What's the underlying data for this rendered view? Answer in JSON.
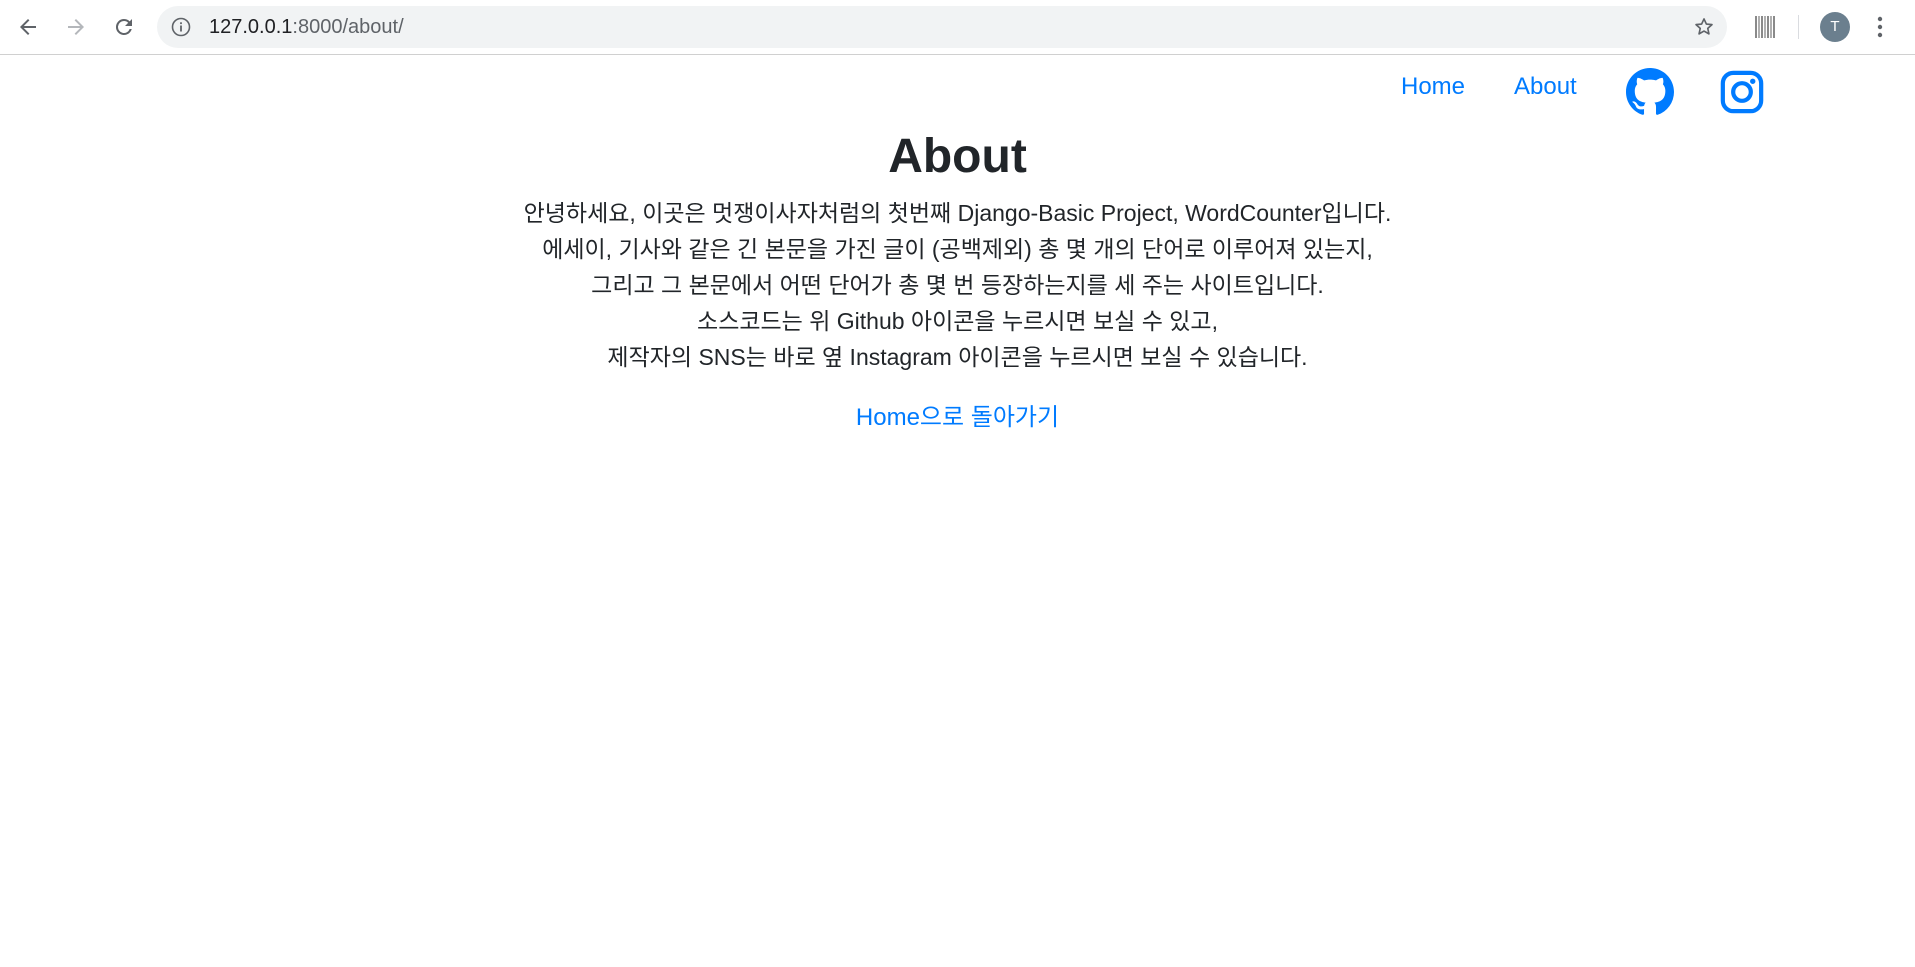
{
  "browser": {
    "url_host": "127.0.0.1",
    "url_rest": ":8000/about/",
    "profile_initial": "T"
  },
  "nav": {
    "links": [
      {
        "label": "Home"
      },
      {
        "label": "About"
      }
    ],
    "icons": [
      "github-icon",
      "instagram-icon"
    ],
    "accent_color": "#007bff"
  },
  "main": {
    "title": "About",
    "lines": [
      "안녕하세요, 이곳은 멋쟁이사자처럼의 첫번째 Django-Basic Project, WordCounter입니다.",
      "에세이, 기사와 같은 긴 본문을 가진 글이 (공백제외) 총 몇 개의 단어로 이루어져 있는지,",
      "그리고 그 본문에서 어떤 단어가 총 몇 번 등장하는지를 세 주는 사이트입니다.",
      "소스코드는 위 Github 아이콘을 누르시면 보실 수 있고,",
      "제작자의 SNS는 바로 옆 Instagram 아이콘을 누르시면 보실 수 있습니다."
    ],
    "back_link": "Home으로 돌아가기"
  }
}
